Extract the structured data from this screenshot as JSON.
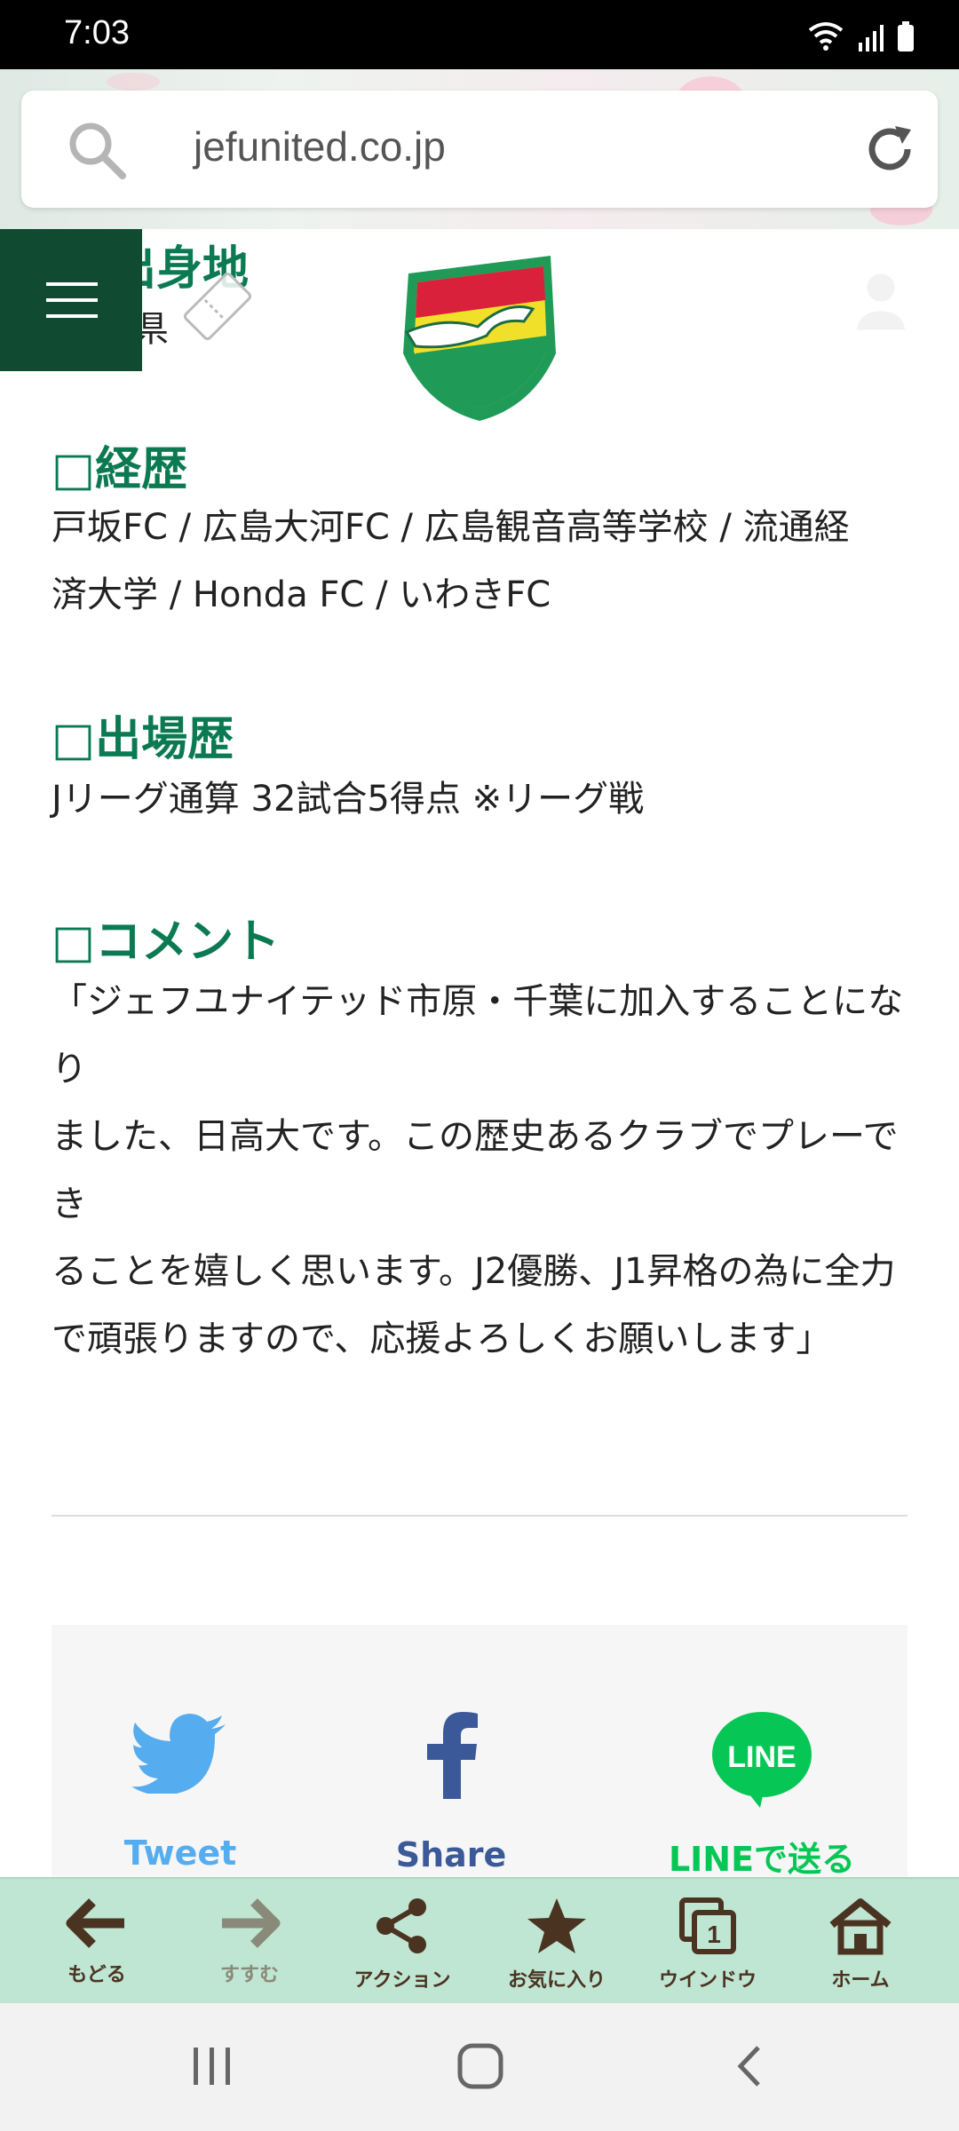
{
  "status_bar": {
    "time": "7:03"
  },
  "browser": {
    "url": "jefunited.co.jp"
  },
  "header": {
    "partial_heading": "出身地",
    "partial_value": "県"
  },
  "sections": [
    {
      "title": "□経歴",
      "lines": [
        "戸坂FC / 広島大河FC / 広島観音高等学校 / 流通経",
        "済大学 / Honda FC / いわきFC"
      ]
    },
    {
      "title": "□出場歴",
      "lines": [
        "Jリーグ通算 32試合5得点 ※リーグ戦"
      ]
    },
    {
      "title": "□コメント",
      "lines": [
        "「ジェフユナイテッド市原・千葉に加入することになり",
        "ました、日高大です。この歴史あるクラブでプレーでき",
        "ることを嬉しく思います。J2優勝、J1昇格の為に全力",
        "で頑張りますので、応援よろしくお願いします」"
      ]
    }
  ],
  "share": {
    "twitter": "Tweet",
    "facebook": "Share",
    "line_logo": "LINE",
    "line": "LINEで送る"
  },
  "toolbar": {
    "back": "もどる",
    "forward": "すすむ",
    "action": "アクション",
    "favorite": "お気に入り",
    "window": "ウインドウ",
    "window_count": "1",
    "home": "ホーム"
  },
  "colors": {
    "accent": "#0b7a53",
    "twitter": "#55acee",
    "facebook": "#3b5998",
    "line": "#06c755",
    "menu": "#0f4a31"
  }
}
